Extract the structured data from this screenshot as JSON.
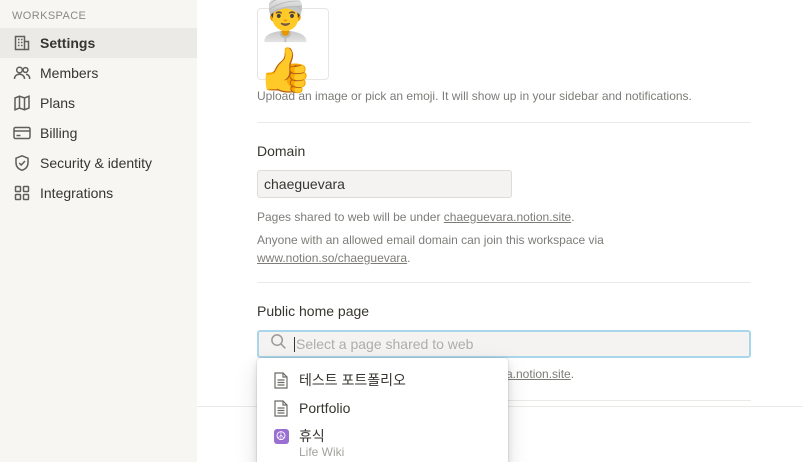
{
  "sidebar": {
    "section_label": "WORKSPACE",
    "items": [
      {
        "label": "Settings",
        "icon": "building-icon",
        "active": true
      },
      {
        "label": "Members",
        "icon": "people-icon"
      },
      {
        "label": "Plans",
        "icon": "map-icon"
      },
      {
        "label": "Billing",
        "icon": "credit-card-icon"
      },
      {
        "label": "Security & identity",
        "icon": "shield-check-icon"
      },
      {
        "label": "Integrations",
        "icon": "grid-icon"
      }
    ]
  },
  "main": {
    "workspace_icon": "👳‍♂️👍",
    "icon_hint": "Upload an image or pick an emoji. It will show up in your sidebar and notifications.",
    "domain": {
      "label": "Domain",
      "value": "chaeguevara",
      "hint_prefix": "Pages shared to web will be under ",
      "hint_link": "chaeguevara.notion.site",
      "hint_suffix": ".",
      "join_prefix": "Anyone with an allowed email domain can join this workspace via",
      "join_link": "www.notion.so/chaeguevara",
      "join_suffix": "."
    },
    "public_home": {
      "label": "Public home page",
      "placeholder": "Select a page shared to web",
      "behind_link": "a.notion.site",
      "behind_suffix": "."
    }
  },
  "dropdown": {
    "items": [
      {
        "label": "테스트 포트폴리오",
        "icon": "page-icon"
      },
      {
        "label": "Portfolio",
        "icon": "page-icon"
      },
      {
        "label": "휴식",
        "icon": "peace-icon",
        "sub": "Life Wiki"
      }
    ]
  },
  "colors": {
    "sidebar_bg": "#f7f6f3",
    "focus_ring": "#a9d6ea",
    "peace_icon": "#9b6fd1"
  }
}
